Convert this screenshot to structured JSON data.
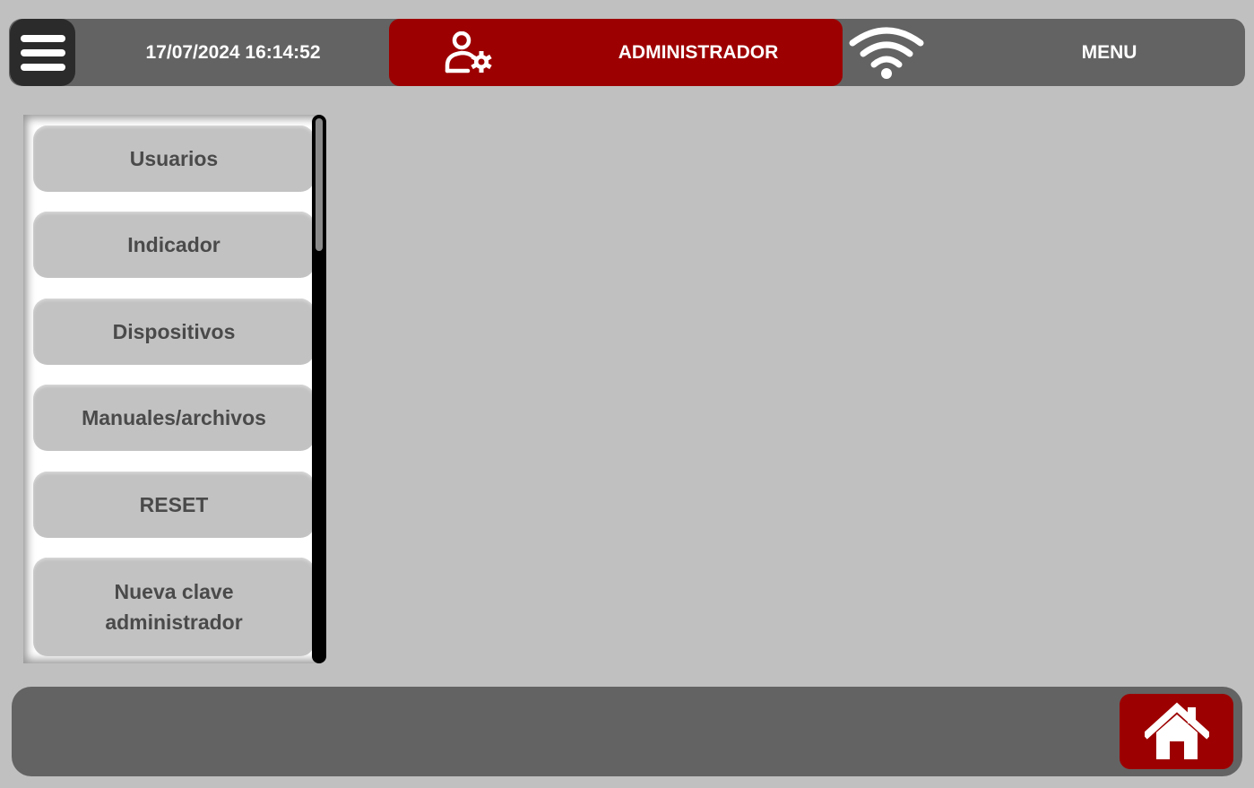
{
  "header": {
    "datetime": "17/07/2024 16:14:52",
    "role_label": "ADMINISTRADOR",
    "menu_label": "MENU",
    "icons": [
      "menu-icon",
      "user-settings-icon",
      "wifi-icon"
    ]
  },
  "sidebar": {
    "items": [
      {
        "label": "Usuarios"
      },
      {
        "label": "Indicador"
      },
      {
        "label": "Dispositivos"
      },
      {
        "label": "Manuales/archivos"
      },
      {
        "label": "RESET"
      },
      {
        "label": "Nueva clave\nadministrador"
      }
    ]
  },
  "footer": {
    "icons": [
      "home-icon"
    ]
  },
  "colors": {
    "background": "#c0c0c0",
    "bar": "#636363",
    "accent": "#9d0000",
    "button": "#c2c2c2",
    "button_text": "#4a4a4a"
  }
}
